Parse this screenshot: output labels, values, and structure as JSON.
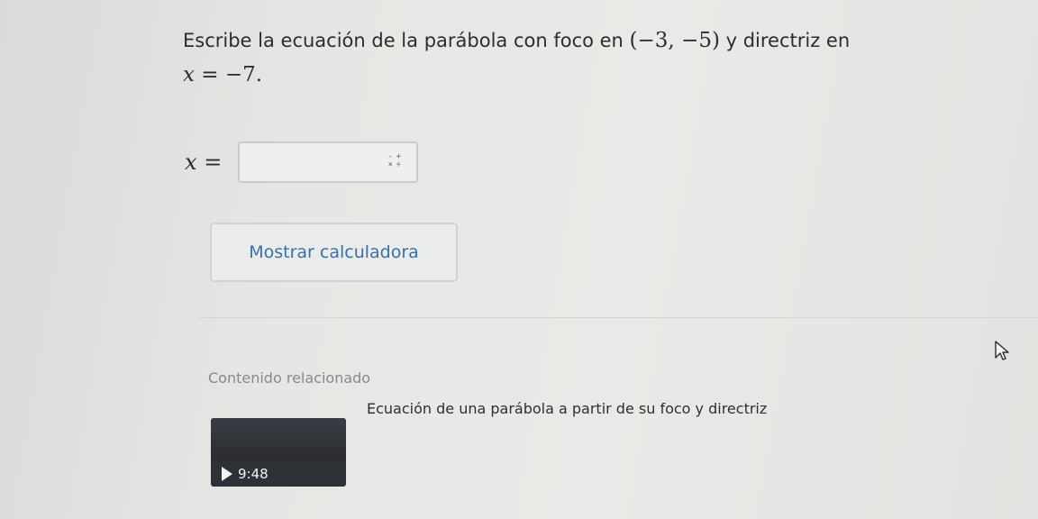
{
  "question": {
    "text_before": "Escribe la ecuación de la parábola con foco en ",
    "focus": "(−3, −5)",
    "text_middle": " y directriz en",
    "directrix_var": "x",
    "directrix_eq": " = −7."
  },
  "answer": {
    "variable": "x",
    "equals": "=",
    "value": "",
    "icon": "math-keyboard-icon"
  },
  "calculator_button": {
    "label": "Mostrar calculadora"
  },
  "related": {
    "title": "Contenido relacionado",
    "video": {
      "title": "Ecuación de una parábola a partir de su foco y directriz",
      "duration": "9:48",
      "icon": "play-icon"
    }
  },
  "colors": {
    "link": "#3b6fa8",
    "text": "#2d2f32",
    "muted": "#858a90"
  }
}
